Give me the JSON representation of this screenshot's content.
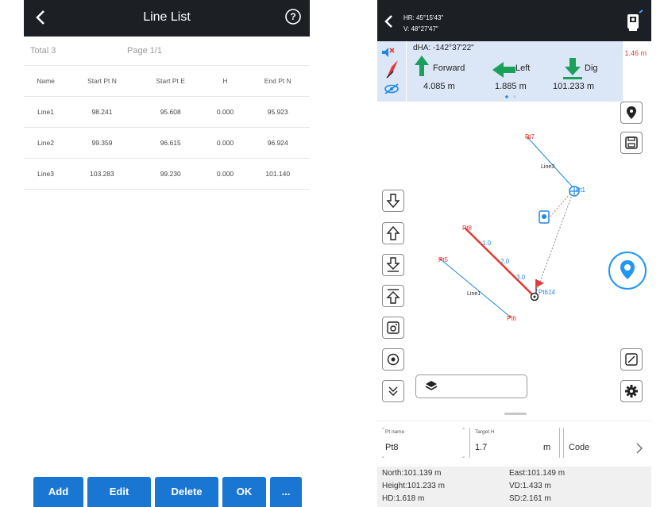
{
  "left_screen": {
    "title": "Line List",
    "total": "Total 3",
    "page": "Page 1/1",
    "columns": [
      "Name",
      "Start Pt N",
      "Start Pt E",
      "H",
      "End Pt N"
    ],
    "rows": [
      [
        "Line1",
        "98.241",
        "95.608",
        "0.000",
        "95.923"
      ],
      [
        "Line2",
        "99.359",
        "96.615",
        "0.000",
        "96.924"
      ],
      [
        "Line3",
        "103.283",
        "99.230",
        "0.000",
        "101.140"
      ]
    ],
    "buttons": {
      "add": "Add",
      "edit": "Edit",
      "delete": "Delete",
      "ok": "OK",
      "more": "..."
    },
    "accent_color": "#1976d2"
  },
  "right_screen": {
    "header": {
      "hr": "HR: 45°15'43\"",
      "v": "V: 48°27'47\""
    },
    "nav_panel": {
      "dha": "dHA: -142°37'22\"",
      "forward_label": "Forward",
      "forward_value": "4.085 m",
      "left_label": "Left",
      "left_value": "1.885 m",
      "dig_label": "Dig",
      "dig_value": "101.233 m",
      "arrow_color": "#1aa05a",
      "side_value": "1.46 m"
    },
    "map_labels": {
      "pt7": "Pt7",
      "line3": "Line3",
      "pt1": "Pt1",
      "pt8": "Pt8",
      "d1": "1.0",
      "d2": "2.0",
      "d3": "3.0",
      "pt5": "Pt5",
      "line1": "Line1",
      "pt6": "Pt6",
      "flag_label": "Pt614"
    },
    "fields": {
      "pt_name_label": "Pt name",
      "pt_name_value": "Pt8",
      "target_h_label": "Target H",
      "target_h_value": "1.7",
      "unit": "m",
      "code_placeholder": "Code"
    },
    "stats": {
      "north": "North:101.139 m",
      "east": "East:101.149 m",
      "height": "Height:101.233 m",
      "vd": "VD:1.433 m",
      "hd": "HD:1.618 m",
      "sd": "SD:2.161 m"
    }
  }
}
